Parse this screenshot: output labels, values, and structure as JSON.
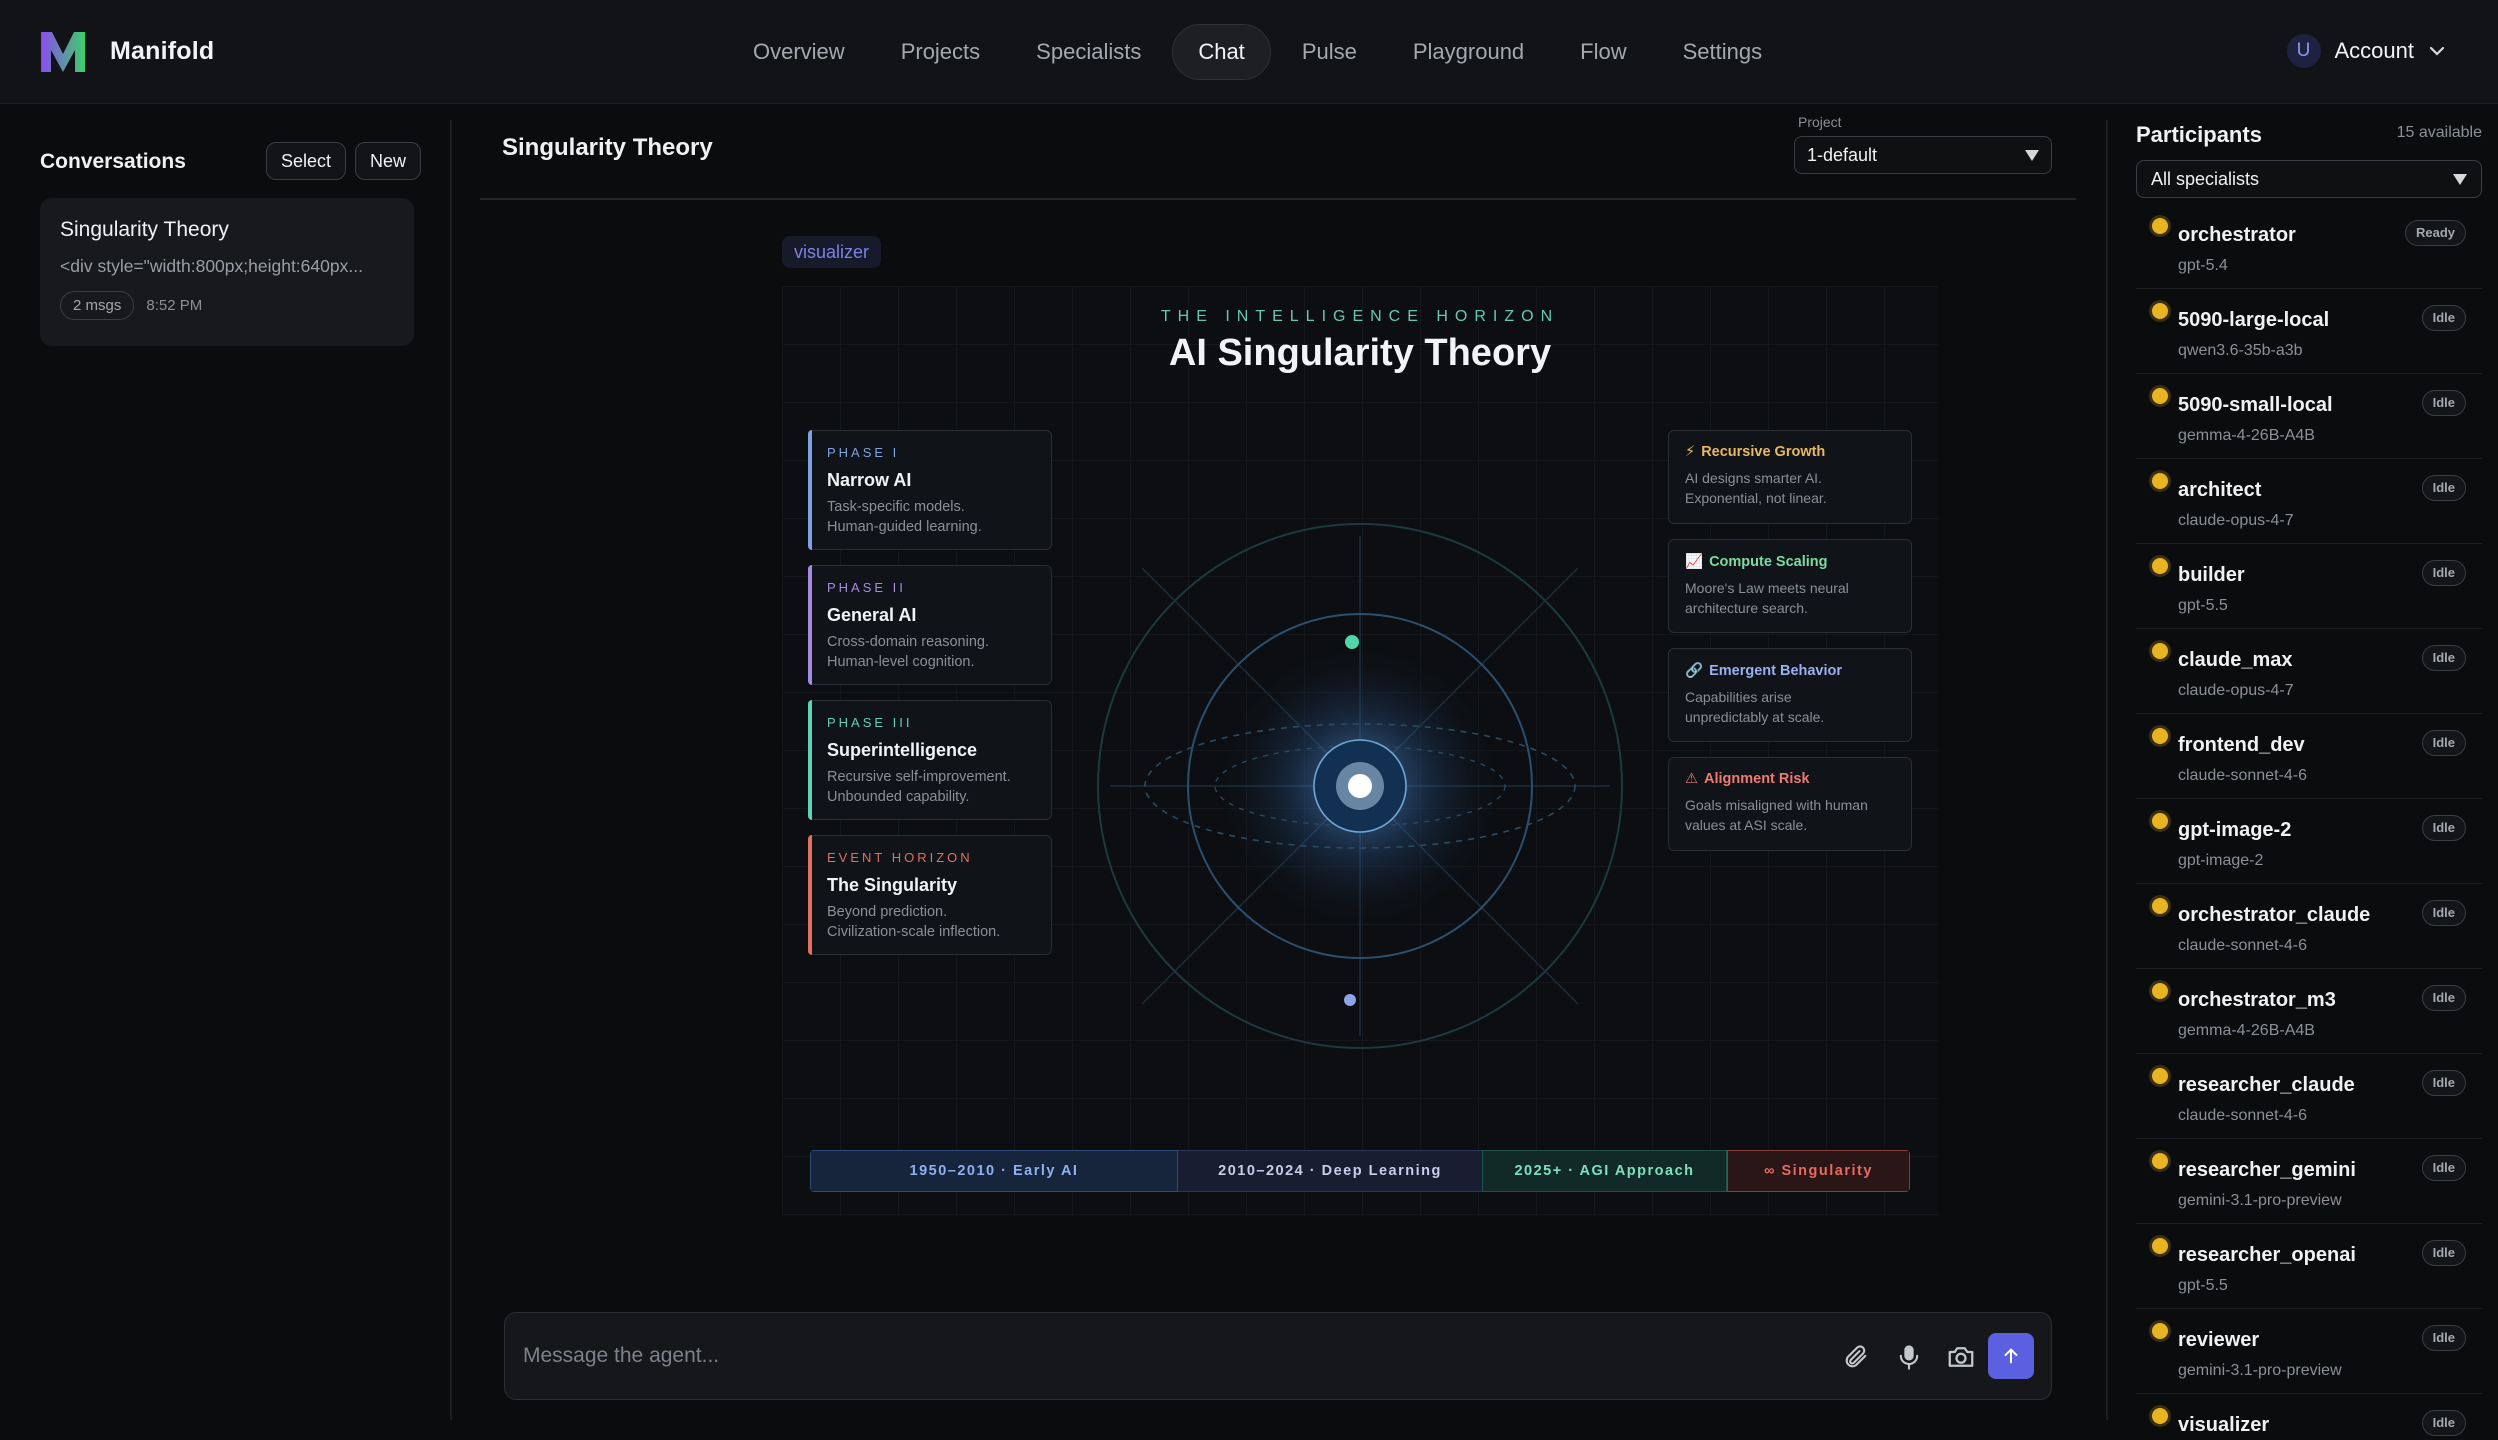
{
  "app": {
    "name": "Manifold"
  },
  "nav": {
    "items": [
      "Overview",
      "Projects",
      "Specialists",
      "Chat",
      "Pulse",
      "Playground",
      "Flow",
      "Settings"
    ],
    "active": "Chat"
  },
  "account": {
    "initial": "U",
    "label": "Account"
  },
  "sidebar": {
    "title": "Conversations",
    "select_label": "Select",
    "new_label": "New",
    "conversations": [
      {
        "title": "Singularity Theory",
        "preview": "<div style=\"width:800px;height:640px...",
        "msgs": "2 msgs",
        "time": "8:52 PM"
      }
    ]
  },
  "chat": {
    "title": "Singularity Theory",
    "project_label": "Project",
    "project_value": "1-default",
    "specialist_tag": "visualizer",
    "composer_placeholder": "Message the agent..."
  },
  "visual": {
    "eyebrow": "THE INTELLIGENCE HORIZON",
    "title": "AI Singularity Theory",
    "phases": [
      {
        "label": "PHASE I",
        "title": "Narrow AI",
        "desc1": "Task-specific models.",
        "desc2": "Human-guided learning.",
        "color": "#7fa2e0"
      },
      {
        "label": "PHASE II",
        "title": "General AI",
        "desc1": "Cross-domain reasoning.",
        "desc2": "Human-level cognition.",
        "color": "#a58be0"
      },
      {
        "label": "PHASE III",
        "title": "Superintelligence",
        "desc1": "Recursive self-improvement.",
        "desc2": "Unbounded capability.",
        "color": "#5fd1b4"
      },
      {
        "label": "EVENT HORIZON",
        "title": "The Singularity",
        "desc1": "Beyond prediction.",
        "desc2": "Civilization-scale inflection.",
        "color": "#e0705f"
      }
    ],
    "features": [
      {
        "icon": "⚡",
        "title": "Recursive Growth",
        "desc1": "AI designs smarter AI.",
        "desc2": "Exponential, not linear.",
        "color": "#e8b864"
      },
      {
        "icon": "📈",
        "title": "Compute Scaling",
        "desc1": "Moore's Law meets neural",
        "desc2": "architecture search.",
        "color": "#7cdca0"
      },
      {
        "icon": "🔗",
        "title": "Emergent Behavior",
        "desc1": "Capabilities arise",
        "desc2": "unpredictably at scale.",
        "color": "#9ab0f0"
      },
      {
        "icon": "⚠",
        "title": "Alignment Risk",
        "desc1": "Goals misaligned with human",
        "desc2": "values at ASI scale.",
        "color": "#f07a72"
      }
    ],
    "timeline": [
      {
        "label": "1950–2010 · Early AI",
        "color": "#8fb0f0",
        "bg": "#16243c"
      },
      {
        "label": "2010–2024 · Deep Learning",
        "color": "#c8cde8",
        "bg": "#181d32"
      },
      {
        "label": "2025+ · AGI Approach",
        "color": "#7fe0c0",
        "bg": "#112a27"
      },
      {
        "label": "∞ Singularity",
        "color": "#e86a5e",
        "bg": "#2a1616"
      }
    ]
  },
  "participants": {
    "title": "Participants",
    "count": "15 available",
    "filter": "All specialists",
    "items": [
      {
        "name": "orchestrator",
        "model": "gpt-5.4",
        "status": "Ready"
      },
      {
        "name": "5090-large-local",
        "model": "qwen3.6-35b-a3b",
        "status": "Idle"
      },
      {
        "name": "5090-small-local",
        "model": "gemma-4-26B-A4B",
        "status": "Idle"
      },
      {
        "name": "architect",
        "model": "claude-opus-4-7",
        "status": "Idle"
      },
      {
        "name": "builder",
        "model": "gpt-5.5",
        "status": "Idle"
      },
      {
        "name": "claude_max",
        "model": "claude-opus-4-7",
        "status": "Idle"
      },
      {
        "name": "frontend_dev",
        "model": "claude-sonnet-4-6",
        "status": "Idle"
      },
      {
        "name": "gpt-image-2",
        "model": "gpt-image-2",
        "status": "Idle"
      },
      {
        "name": "orchestrator_claude",
        "model": "claude-sonnet-4-6",
        "status": "Idle"
      },
      {
        "name": "orchestrator_m3",
        "model": "gemma-4-26B-A4B",
        "status": "Idle"
      },
      {
        "name": "researcher_claude",
        "model": "claude-sonnet-4-6",
        "status": "Idle"
      },
      {
        "name": "researcher_gemini",
        "model": "gemini-3.1-pro-preview",
        "status": "Idle"
      },
      {
        "name": "researcher_openai",
        "model": "gpt-5.5",
        "status": "Idle"
      },
      {
        "name": "reviewer",
        "model": "gemini-3.1-pro-preview",
        "status": "Idle"
      },
      {
        "name": "visualizer",
        "model": "",
        "status": "Idle"
      }
    ]
  },
  "icons": {
    "logo": "manifold-logo",
    "attach": "paperclip-icon",
    "mic": "microphone-icon",
    "camera": "camera-icon",
    "send": "arrow-up-icon"
  }
}
